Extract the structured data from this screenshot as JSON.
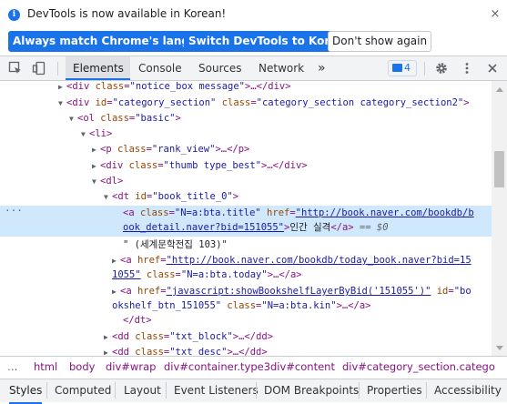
{
  "infobar": {
    "message": "DevTools is now available in Korean!",
    "btn_match": "Always match Chrome's language",
    "btn_switch": "Switch DevTools to Korean",
    "btn_dismiss": "Don't show again",
    "close": "×"
  },
  "tabs": {
    "elements": "Elements",
    "console": "Console",
    "sources": "Sources",
    "network": "Network",
    "more": "»",
    "issues_count": "4"
  },
  "tree": {
    "l0_tag_open": "<div ",
    "l0_attr1_name": "class",
    "l0_attr1_val": "\"notice_box message\"",
    "l0_rest": ">…</div>",
    "l1_tag_open": "<div ",
    "l1_attr1_name": "id",
    "l1_attr1_val": "\"category_section\"",
    "l1_attr2_name": " class",
    "l1_attr2_val": "\"category_section category_section2\"",
    "l1_rest": ">",
    "l2_tag": "<ol ",
    "l2_attr_name": "class",
    "l2_attr_val": "\"basic\"",
    "l2_rest": ">",
    "l3_tag": "<li>",
    "l4_tag": "<p ",
    "l4_attr_name": "class",
    "l4_attr_val": "\"rank_view\"",
    "l4_rest": ">…</p>",
    "l5_tag": "<div ",
    "l5_attr_name": "class",
    "l5_attr_val": "\"thumb type_best\"",
    "l5_rest": ">…</div>",
    "l6_tag": "<dl>",
    "l7_tag": "<dt ",
    "l7_attr_name": "id",
    "l7_attr_val": "\"book_title_0\"",
    "l7_rest": ">",
    "l8_tag": "<a ",
    "l8_attr1_name": "class",
    "l8_attr1_val": "\"N=a:bta.title\"",
    "l8_attr2_name": " href",
    "l8_href_a": "\"http://book.naver.com/bookdb/b",
    "l8_href_b": "ook_detail.naver?bid=151055\"",
    "l8_gt": ">",
    "l8_text": "인간 실격",
    "l8_close": "</a>",
    "l8_eq": " == $0",
    "l9_text": "\" (세계문학전집 103)\"",
    "l10_tag": "<a ",
    "l10_attr_name": "href",
    "l10_href_a": "\"http://book.naver.com/bookdb/today_book.naver?bid=15",
    "l10_href_b": "1055\"",
    "l10_attr2_name": " class",
    "l10_attr2_val": "\"N=a:bta.today\"",
    "l10_rest": ">…</a>",
    "l11_tag": "<a ",
    "l11_attr_name": "href",
    "l11_href": "\"javascript:showBookshelfLayerByBid('151055')\"",
    "l11_attr2_name": " id",
    "l11_attr2_val_a": "\"bo",
    "l11_attr2_val_b": "okshelf_btn_151055\"",
    "l11_attr3_name": " class",
    "l11_attr3_val": "\"N=a:bta.kin\"",
    "l11_rest": ">…</a>",
    "l12_tag": "</dt>",
    "l13_tag": "<dd ",
    "l13_attr_name": "class",
    "l13_attr_val": "\"txt_block\"",
    "l13_rest": ">…</dd>",
    "l14_tag": "<dd ",
    "l14_attr_name": "class",
    "l14_attr_val": "\"txt_desc\"",
    "l14_rest": ">…</dd>"
  },
  "breadcrumbs": {
    "more": "…",
    "items": [
      "html",
      "body",
      "div#wrap",
      "div#container.type3",
      "div#content",
      "div#category_section.catego"
    ]
  },
  "subtabs": [
    "Styles",
    "Computed",
    "Layout",
    "Event Listeners",
    "DOM Breakpoints",
    "Properties",
    "Accessibility"
  ],
  "colors": {
    "accent": "#1a73e8",
    "tag": "#881280",
    "attr_name": "#994500",
    "attr_value": "#1a1aa6",
    "selection": "#cfe8fc"
  }
}
